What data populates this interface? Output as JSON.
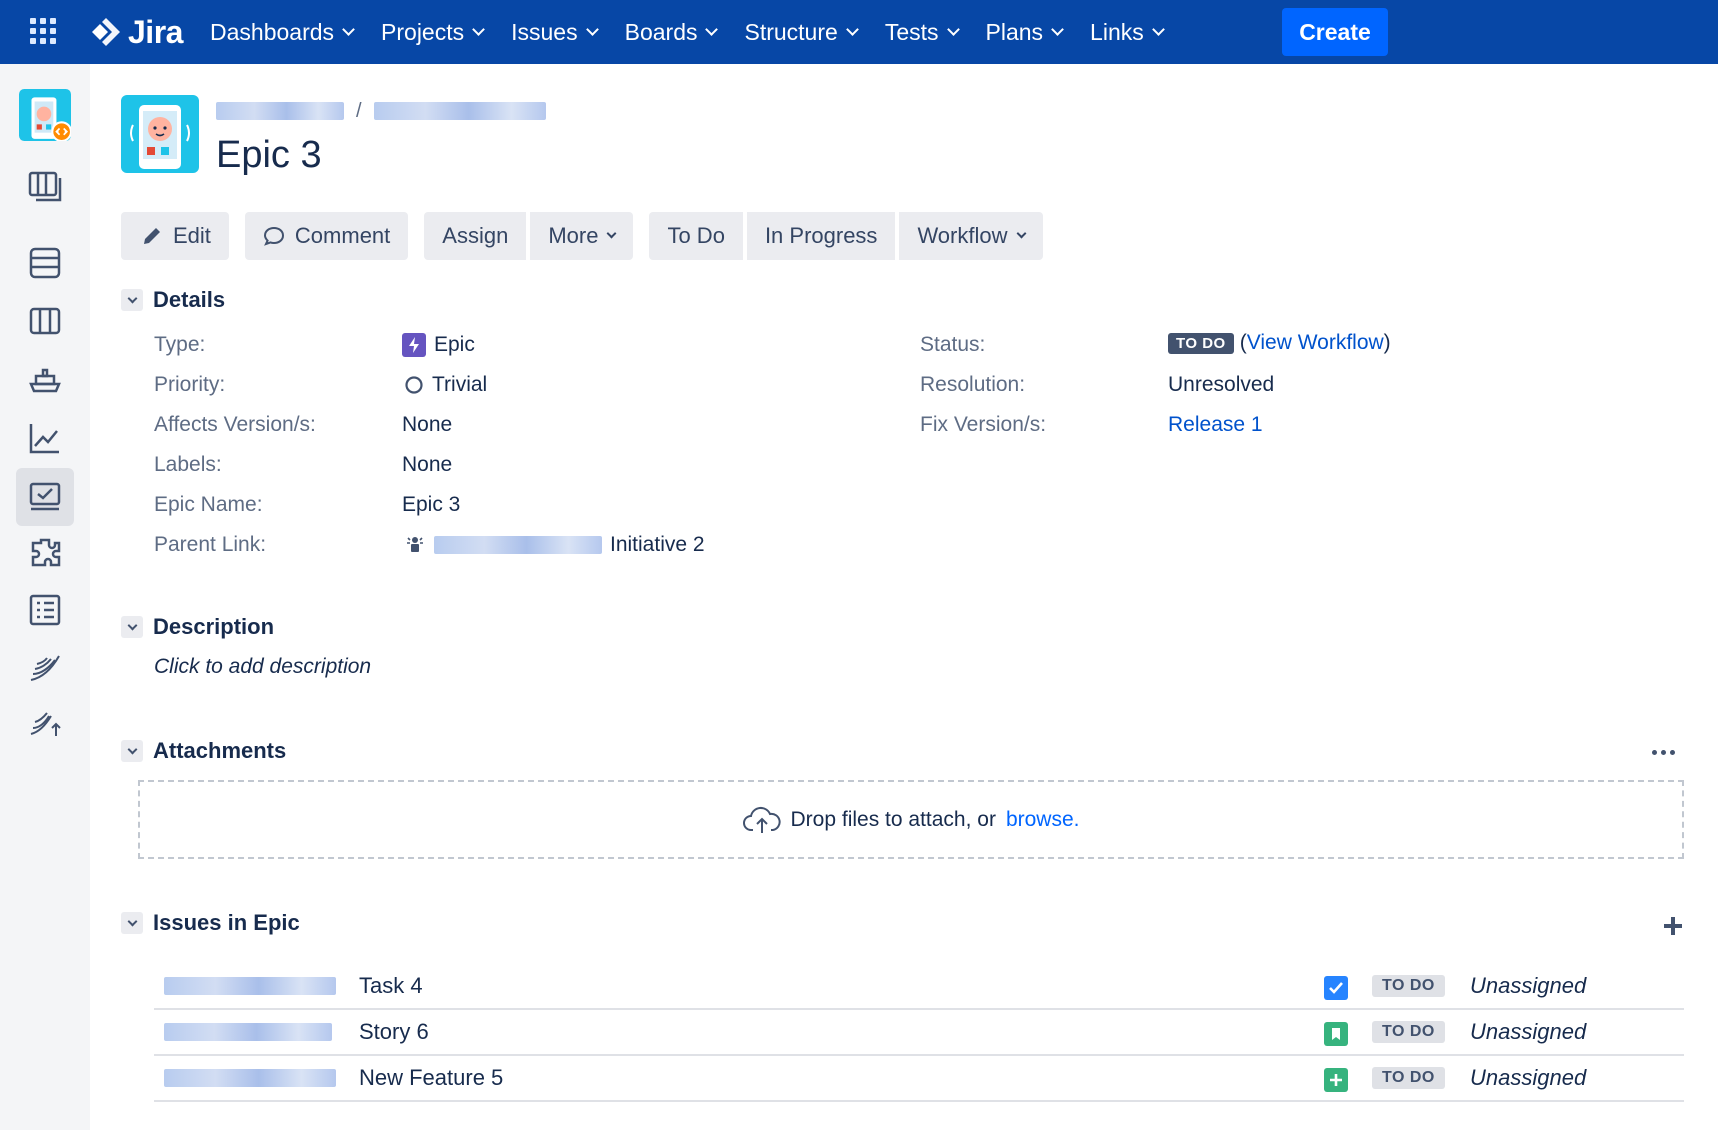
{
  "nav": {
    "logo": "Jira",
    "items": [
      {
        "label": "Dashboards"
      },
      {
        "label": "Projects"
      },
      {
        "label": "Issues"
      },
      {
        "label": "Boards"
      },
      {
        "label": "Structure"
      },
      {
        "label": "Tests"
      },
      {
        "label": "Plans"
      },
      {
        "label": "Links"
      }
    ],
    "create_label": "Create"
  },
  "issue": {
    "breadcrumb_separator": "/",
    "title": "Epic 3"
  },
  "toolbar": {
    "edit": "Edit",
    "comment": "Comment",
    "assign": "Assign",
    "more": "More",
    "to_do": "To Do",
    "in_progress": "In Progress",
    "workflow": "Workflow"
  },
  "details": {
    "heading": "Details",
    "type_label": "Type:",
    "type_value": "Epic",
    "priority_label": "Priority:",
    "priority_value": "Trivial",
    "affects_label": "Affects Version/s:",
    "affects_value": "None",
    "labels_label": "Labels:",
    "labels_value": "None",
    "epic_name_label": "Epic Name:",
    "epic_name_value": "Epic 3",
    "parent_label": "Parent Link:",
    "parent_value": "Initiative 2",
    "status_label": "Status:",
    "status_value": "TO DO",
    "view_workflow_open": "(",
    "view_workflow": "View Workflow",
    "view_workflow_close": ")",
    "resolution_label": "Resolution:",
    "resolution_value": "Unresolved",
    "fix_label": "Fix Version/s:",
    "fix_value": "Release 1"
  },
  "description": {
    "heading": "Description",
    "placeholder": "Click to add description"
  },
  "attachments": {
    "heading": "Attachments",
    "drop_text": "Drop files to attach, or",
    "browse": "browse."
  },
  "issues_in_epic": {
    "heading": "Issues in Epic",
    "rows": [
      {
        "summary": "Task 4",
        "type": "task",
        "status": "TO DO",
        "assignee": "Unassigned"
      },
      {
        "summary": "Story 6",
        "type": "story",
        "status": "TO DO",
        "assignee": "Unassigned"
      },
      {
        "summary": "New Feature 5",
        "type": "new-feature",
        "status": "TO DO",
        "assignee": "Unassigned"
      }
    ]
  },
  "colors": {
    "nav_bg": "#0747a6",
    "create": "#0065ff",
    "link": "#0052cc",
    "epic": "#6554c0",
    "task": "#2684ff",
    "story": "#36b37e"
  }
}
